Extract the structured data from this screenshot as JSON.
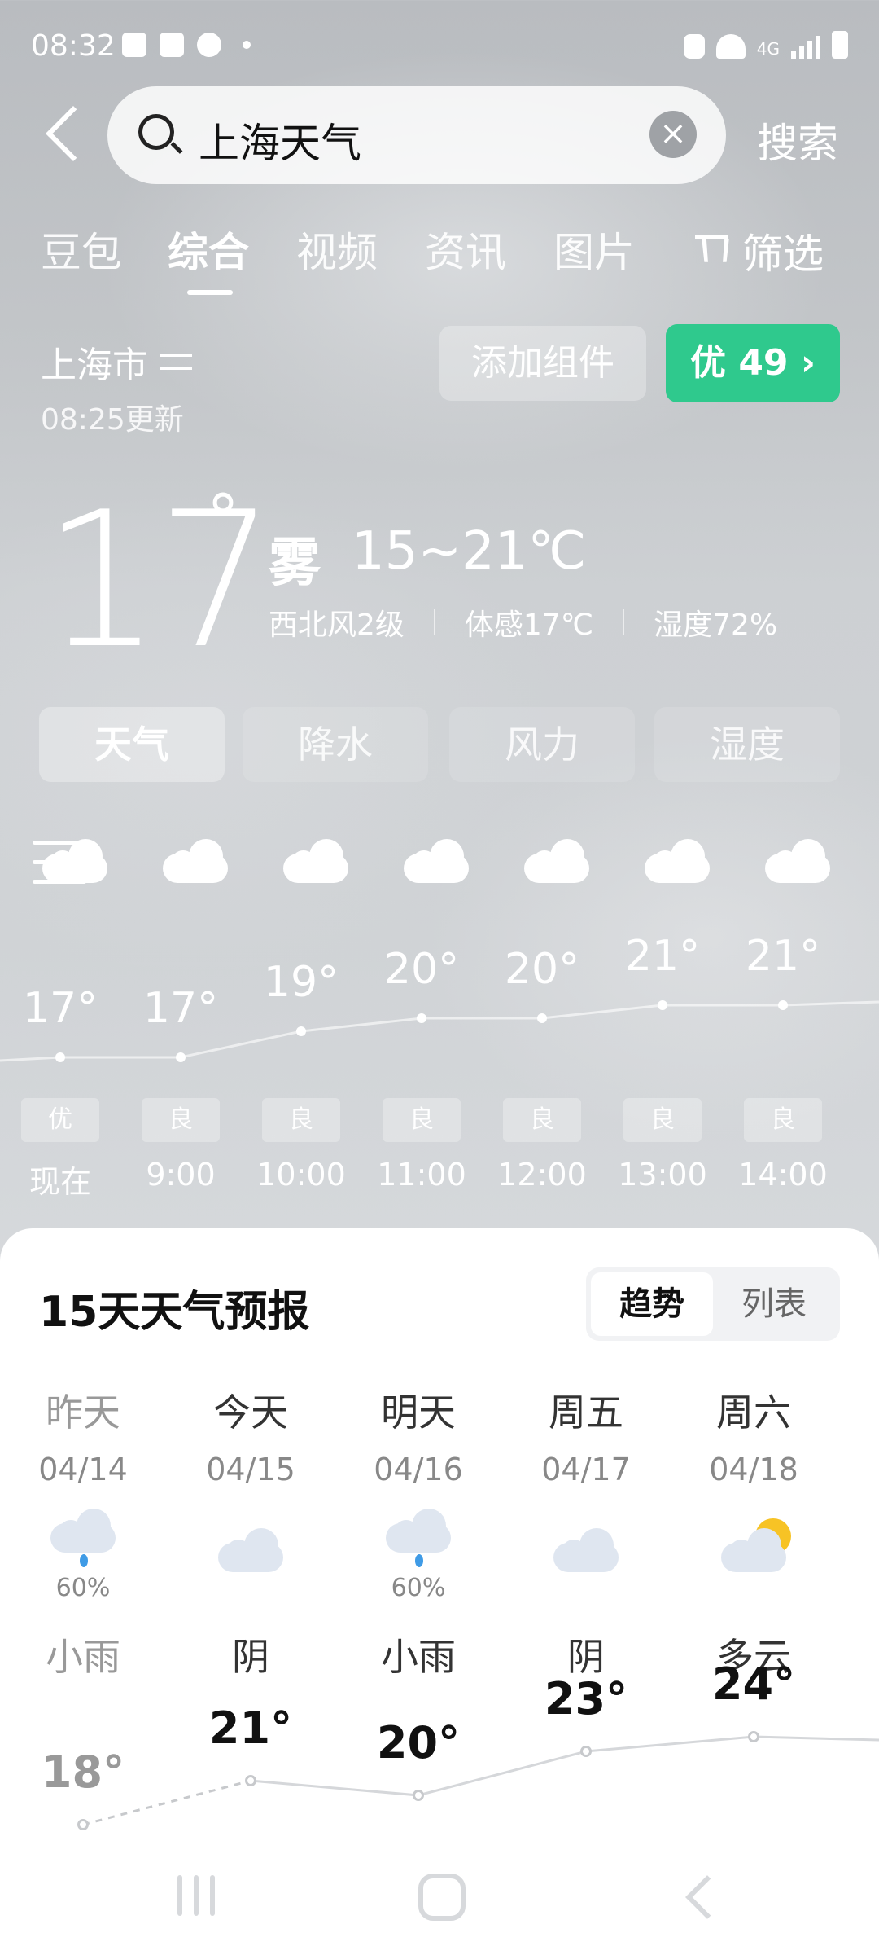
{
  "status_bar": {
    "time": "08:32",
    "network": "4G"
  },
  "search": {
    "query": "上海天气",
    "button_label": "搜索"
  },
  "tabs": [
    {
      "label": "豆包",
      "active": false
    },
    {
      "label": "综合",
      "active": true
    },
    {
      "label": "视频",
      "active": false
    },
    {
      "label": "资讯",
      "active": false
    },
    {
      "label": "图片",
      "active": false
    }
  ],
  "filter_label": "筛选",
  "weather": {
    "city": "上海市",
    "updated": "08:25更新",
    "add_widget_label": "添加组件",
    "aqi_label": "优 49 ›",
    "current_temp": "17",
    "degree_symbol": "°",
    "condition": "雾",
    "range": "15~21℃",
    "wind": "西北风2级",
    "feels_like": "体感17℃",
    "humidity": "湿度72%"
  },
  "segments": [
    {
      "label": "天气",
      "active": true
    },
    {
      "label": "降水",
      "active": false
    },
    {
      "label": "风力",
      "active": false
    },
    {
      "label": "湿度",
      "active": false
    }
  ],
  "hourly": [
    {
      "time": "现在",
      "temp": "17°",
      "value": 17,
      "aqi": "优"
    },
    {
      "time": "9:00",
      "temp": "17°",
      "value": 17,
      "aqi": "良"
    },
    {
      "time": "10:00",
      "temp": "19°",
      "value": 19,
      "aqi": "良"
    },
    {
      "time": "11:00",
      "temp": "20°",
      "value": 20,
      "aqi": "良"
    },
    {
      "time": "12:00",
      "temp": "20°",
      "value": 20,
      "aqi": "良"
    },
    {
      "time": "13:00",
      "temp": "21°",
      "value": 21,
      "aqi": "良"
    },
    {
      "time": "14:00",
      "temp": "21°",
      "value": 21,
      "aqi": "良"
    }
  ],
  "forecast": {
    "title": "15天天气预报",
    "toggle": {
      "trend": "趋势",
      "list": "列表"
    },
    "days": [
      {
        "name": "昨天",
        "date": "04/14",
        "icon": "rain-cloud-icon",
        "rain": "60%",
        "cond": "小雨",
        "high": "18°",
        "value": 18,
        "past": true
      },
      {
        "name": "今天",
        "date": "04/15",
        "icon": "cloud-icon",
        "rain": "",
        "cond": "阴",
        "high": "21°",
        "value": 21,
        "past": false
      },
      {
        "name": "明天",
        "date": "04/16",
        "icon": "rain-cloud-icon",
        "rain": "60%",
        "cond": "小雨",
        "high": "20°",
        "value": 20,
        "past": false
      },
      {
        "name": "周五",
        "date": "04/17",
        "icon": "cloud-icon",
        "rain": "",
        "cond": "阴",
        "high": "23°",
        "value": 23,
        "past": false
      },
      {
        "name": "周六",
        "date": "04/18",
        "icon": "partly-cloudy-icon",
        "rain": "",
        "cond": "多云",
        "high": "24°",
        "value": 24,
        "past": false
      }
    ]
  }
}
